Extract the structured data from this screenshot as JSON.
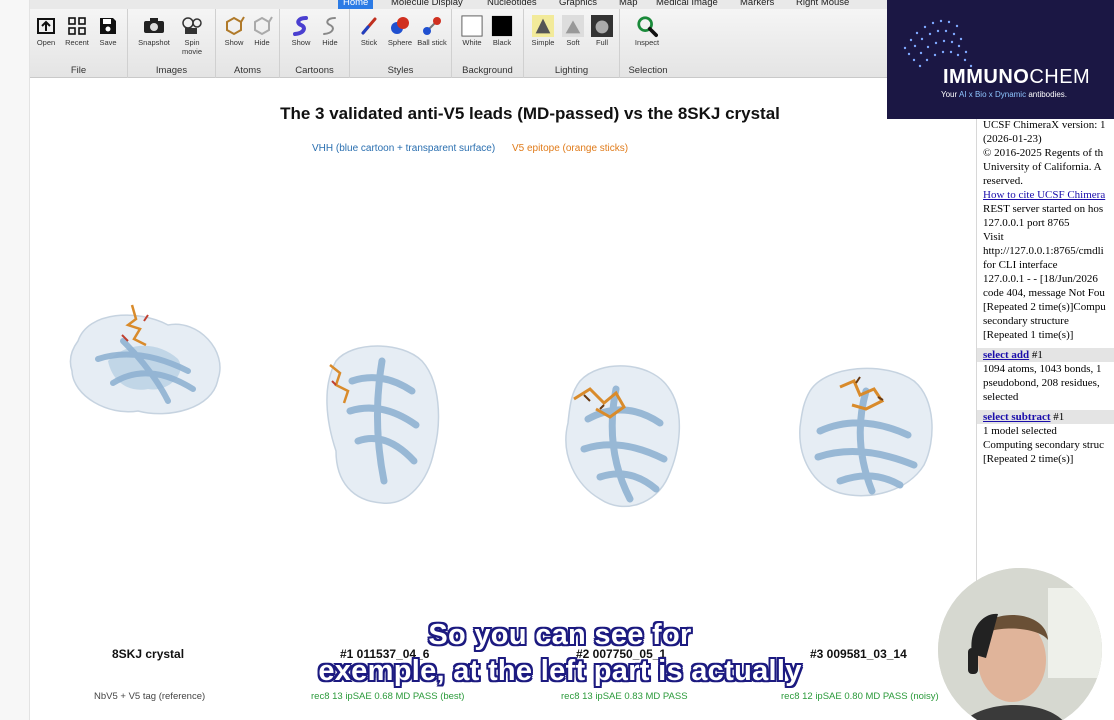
{
  "tabs": [
    "Home",
    "Molecule Display",
    "Nucleotides",
    "Graphics",
    "Map",
    "Medical Image",
    "Markers",
    "Right Mouse"
  ],
  "toolbar": {
    "groups": [
      {
        "label": "File",
        "tools": [
          "Open",
          "Recent",
          "Save"
        ]
      },
      {
        "label": "Images",
        "tools": [
          "Snapshot",
          "Spin movie"
        ]
      },
      {
        "label": "Atoms",
        "tools": [
          "Show",
          "Hide"
        ]
      },
      {
        "label": "Cartoons",
        "tools": [
          "Show",
          "Hide"
        ]
      },
      {
        "label": "Styles",
        "tools": [
          "Stick",
          "Sphere",
          "Ball stick"
        ]
      },
      {
        "label": "Background",
        "tools": [
          "White",
          "Black"
        ]
      },
      {
        "label": "Lighting",
        "tools": [
          "Simple",
          "Soft",
          "Full"
        ]
      },
      {
        "label": "Selection",
        "tools": [
          "Inspect"
        ]
      }
    ]
  },
  "figure": {
    "title": "The 3 validated anti-V5 leads (MD-passed)  vs  the 8SKJ crystal",
    "legend_blue": "VHH (blue cartoon + transparent surface)",
    "legend_orange": "V5 epitope (orange sticks)",
    "panels": [
      {
        "name": "8SKJ crystal",
        "sub": "NbV5 + V5 tag (reference)"
      },
      {
        "name": "#1  011537_04_6",
        "sub": "rec8 13  ipSAE 0.68  MD PASS (best)"
      },
      {
        "name": "#2  007750_05_1",
        "sub": "rec8 13  ipSAE 0.83  MD PASS"
      },
      {
        "name": "#3  009581_03_14",
        "sub": "rec8 12  ipSAE 0.80  MD PASS (noisy)"
      }
    ],
    "colors": {
      "surface": "#e6edf4",
      "cartoon": "#9bbad6",
      "epitope": "#d98b2b",
      "legend_blue": "#2a6fb0",
      "legend_orange": "#e07b1a",
      "pass_green": "#2a9a3a"
    }
  },
  "log": {
    "lines_1": [
      "UCSF ChimeraX version: 1",
      "(2026-01-23)",
      "© 2016-2025 Regents of th",
      "University of California. A",
      "reserved."
    ],
    "cite_link": "How to cite UCSF Chimera",
    "lines_2": [
      "REST server started on hos",
      "127.0.0.1 port 8765",
      "Visit",
      "http://127.0.0.1:8765/cmdli",
      "for CLI interface",
      "127.0.0.1 - - [18/Jun/2026",
      "code 404, message Not Fou",
      "[Repeated 2 time(s)]Compu",
      "secondary structure",
      "[Repeated 1 time(s)]"
    ],
    "cmd1": {
      "cmd": "select add",
      "arg": " #1"
    },
    "lines_3": [
      "1094 atoms, 1043 bonds, 1",
      "pseudobond, 208 residues,",
      "selected"
    ],
    "cmd2": {
      "cmd": "select subtract",
      "arg": " #1"
    },
    "lines_4": [
      "1 model selected",
      "Computing secondary struc",
      "[Repeated 2 time(s)]"
    ]
  },
  "banner": {
    "brand_a": "IMMUNO",
    "brand_b": "CHEM",
    "tag_a": "Your ",
    "tag_b": "AI x Bio x Dynamic",
    "tag_c": " antibodies."
  },
  "subtitles": [
    "So you can see for",
    "exemple, at the left part is actually"
  ]
}
